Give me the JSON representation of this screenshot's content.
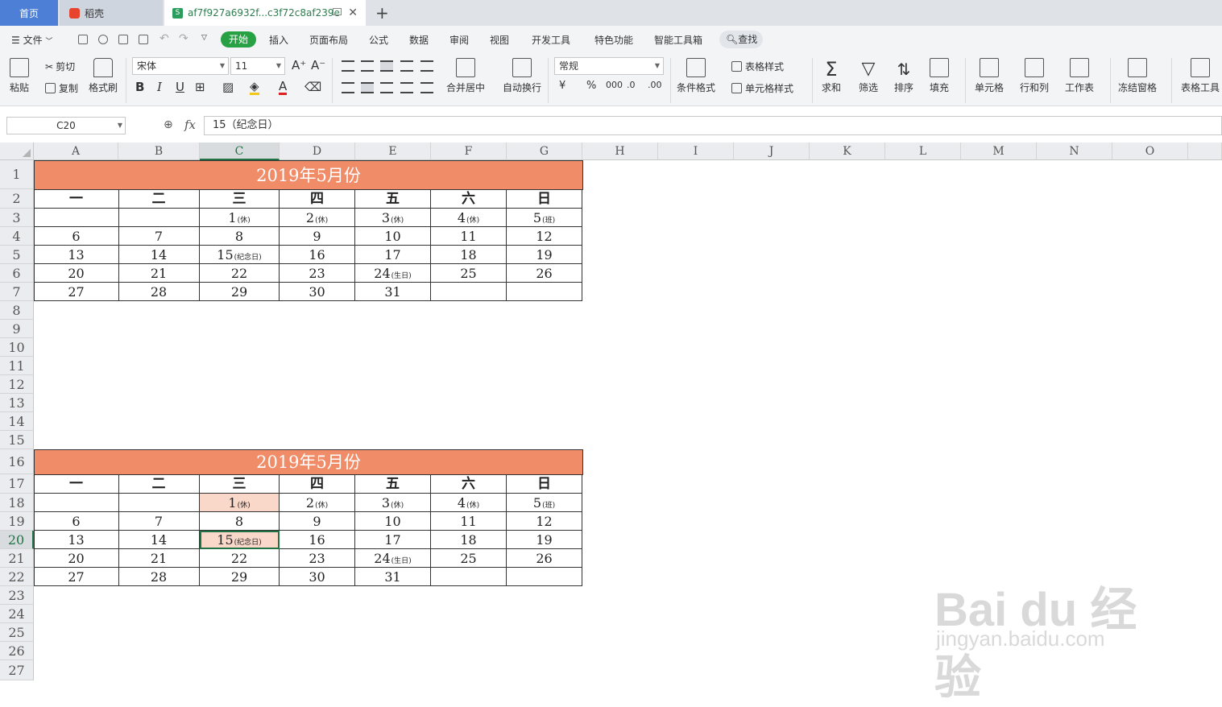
{
  "tabs": {
    "home": "首页",
    "docer": "稻壳",
    "file": "af7f927a6932f...c3f72c8af239e"
  },
  "menu": {
    "file": "文件",
    "items": [
      "开始",
      "插入",
      "页面布局",
      "公式",
      "数据",
      "审阅",
      "视图",
      "开发工具",
      "特色功能",
      "智能工具箱"
    ],
    "find": "查找"
  },
  "ribbon": {
    "paste": "粘贴",
    "cut": "剪切",
    "copy": "复制",
    "format_painter": "格式刷",
    "font_name": "宋体",
    "font_size": "11",
    "merge_center": "合并居中",
    "wrap_text": "自动换行",
    "number_format": "常规",
    "conditional_format": "条件格式",
    "table_style": "表格样式",
    "cell_style": "单元格样式",
    "sum": "求和",
    "filter": "筛选",
    "sort": "排序",
    "fill": "填充",
    "cells": "单元格",
    "rows_cols": "行和列",
    "worksheet": "工作表",
    "freeze": "冻结窗格",
    "table_tools": "表格工具"
  },
  "formula_bar": {
    "name_box": "C20",
    "fx": "fx",
    "value": "15（纪念日）"
  },
  "columns": [
    "A",
    "B",
    "C",
    "D",
    "E",
    "F",
    "G",
    "H",
    "I",
    "J",
    "K",
    "L",
    "M",
    "N",
    "O"
  ],
  "active_column": "C",
  "rows": [
    "1",
    "2",
    "3",
    "4",
    "5",
    "6",
    "7",
    "8",
    "9",
    "10",
    "11",
    "12",
    "13",
    "14",
    "15",
    "16",
    "17",
    "18",
    "19",
    "20",
    "21",
    "22",
    "23",
    "24",
    "25",
    "26",
    "27"
  ],
  "active_row": "20",
  "calendar": {
    "title": "2019年5月份",
    "weekdays": [
      "一",
      "二",
      "三",
      "四",
      "五",
      "六",
      "日"
    ],
    "weeks": [
      [
        {
          "v": "",
          "n": ""
        },
        {
          "v": "",
          "n": ""
        },
        {
          "v": "1",
          "n": "(休)"
        },
        {
          "v": "2",
          "n": "(休)"
        },
        {
          "v": "3",
          "n": "(休)"
        },
        {
          "v": "4",
          "n": "(休)"
        },
        {
          "v": "5",
          "n": "(班)"
        }
      ],
      [
        {
          "v": "6",
          "n": ""
        },
        {
          "v": "7",
          "n": ""
        },
        {
          "v": "8",
          "n": ""
        },
        {
          "v": "9",
          "n": ""
        },
        {
          "v": "10",
          "n": ""
        },
        {
          "v": "11",
          "n": ""
        },
        {
          "v": "12",
          "n": ""
        }
      ],
      [
        {
          "v": "13",
          "n": ""
        },
        {
          "v": "14",
          "n": ""
        },
        {
          "v": "15",
          "n": "(纪念日)"
        },
        {
          "v": "16",
          "n": ""
        },
        {
          "v": "17",
          "n": ""
        },
        {
          "v": "18",
          "n": ""
        },
        {
          "v": "19",
          "n": ""
        }
      ],
      [
        {
          "v": "20",
          "n": ""
        },
        {
          "v": "21",
          "n": ""
        },
        {
          "v": "22",
          "n": ""
        },
        {
          "v": "23",
          "n": ""
        },
        {
          "v": "24",
          "n": "(生日)"
        },
        {
          "v": "25",
          "n": ""
        },
        {
          "v": "26",
          "n": ""
        }
      ],
      [
        {
          "v": "27",
          "n": ""
        },
        {
          "v": "28",
          "n": ""
        },
        {
          "v": "29",
          "n": ""
        },
        {
          "v": "30",
          "n": ""
        },
        {
          "v": "31",
          "n": ""
        },
        {
          "v": "",
          "n": ""
        },
        {
          "v": "",
          "n": ""
        }
      ]
    ]
  },
  "highlight_color": "#f9d7c9",
  "title_color": "#f08c68",
  "accent_color": "#217346",
  "watermark": {
    "brand": "Bai du 经验",
    "url": "jingyan.baidu.com"
  }
}
